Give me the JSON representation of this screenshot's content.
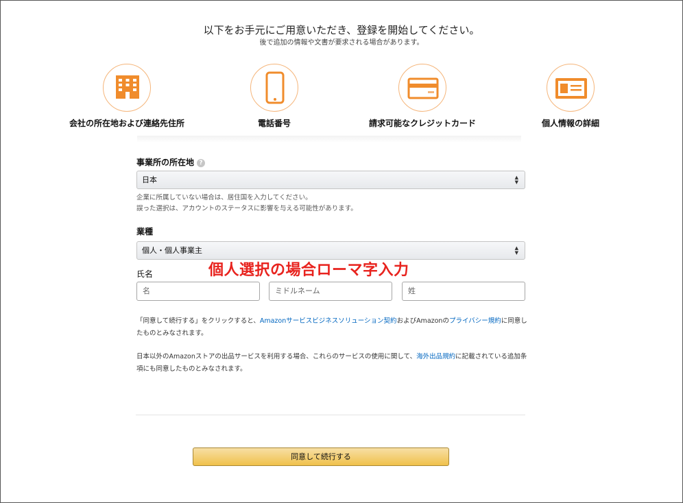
{
  "header": {
    "title": "以下をお手元にご用意いただき、登録を開始してください。",
    "subtitle": "後で追加の情報や文書が要求される場合があります。"
  },
  "steps": [
    {
      "label": "会社の所在地および連絡先住所",
      "icon": "building-icon"
    },
    {
      "label": "電話番号",
      "icon": "phone-icon"
    },
    {
      "label": "請求可能なクレジットカード",
      "icon": "credit-card-icon"
    },
    {
      "label": "個人情報の詳細",
      "icon": "id-card-icon"
    }
  ],
  "colors": {
    "icon_orange": "#f08c2c",
    "link_blue": "#0066c0",
    "annotation_red": "#e8231e",
    "button_yellow": "#f0c14b"
  },
  "form": {
    "location": {
      "label": "事業所の所在地",
      "value": "日本",
      "note1": "企業に所属していない場合は、居住国を入力してください。",
      "note2": "誤った選択は、アカウントのステータスに影響を与える可能性があります。"
    },
    "business_type": {
      "label": "業種",
      "value": "個人・個人事業主"
    },
    "name": {
      "label": "氏名",
      "first_placeholder": "名",
      "middle_placeholder": "ミドルネーム",
      "last_placeholder": "姓"
    }
  },
  "annotation": "個人選択の場合ローマ字入力",
  "agreement": {
    "p1_a": "「同意して続行する」をクリックすると、",
    "p1_link1": "Amazonサービスビジネスソリューション契約",
    "p1_b": "およびAmazonの",
    "p1_link2": "プライバシー規約",
    "p1_c": "に同意したものとみなされます。",
    "p2_a": "日本以外のAmazonストアの出品サービスを利用する場合、これらのサービスの使用に関して、",
    "p2_link": "海外出品規約",
    "p2_b": "に記載されている追加条項にも同意したものとみなされます。"
  },
  "submit_label": "同意して続行する"
}
